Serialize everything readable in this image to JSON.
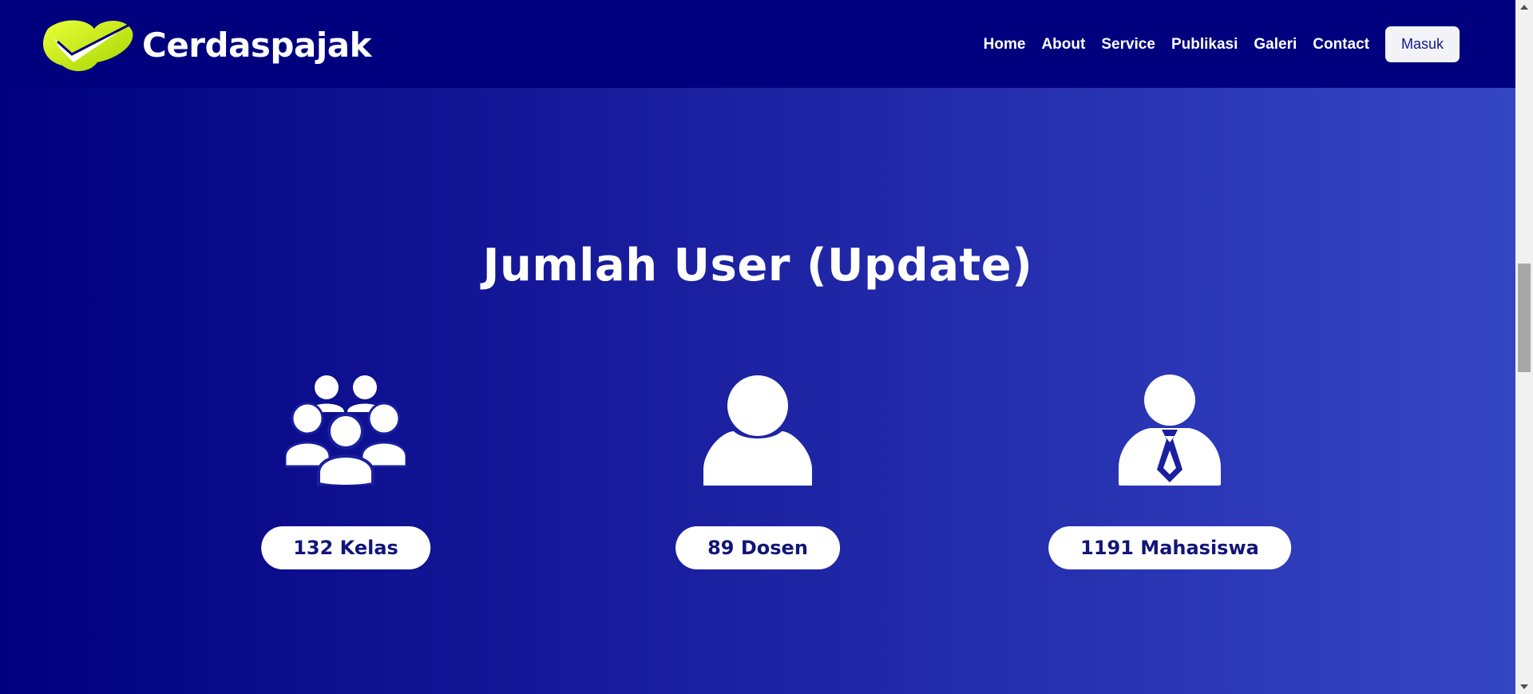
{
  "brand": {
    "name": "Cerdaspajak",
    "logo_icon": "check-mark-logo-icon",
    "logo_color": "#c6f511"
  },
  "nav": {
    "links": [
      "Home",
      "About",
      "Service",
      "Publikasi",
      "Galeri",
      "Contact"
    ],
    "login_label": "Masuk"
  },
  "section": {
    "title": "Jumlah User (Update)"
  },
  "stats": [
    {
      "icon": "group-users-icon",
      "label": "132 Kelas"
    },
    {
      "icon": "user-icon",
      "label": "89 Dosen"
    },
    {
      "icon": "user-tie-icon",
      "label": "1191 Mahasiswa"
    }
  ],
  "colors": {
    "nav_bg": "#00007f",
    "gradient_end": "#3546c4",
    "pill_text": "#13157a"
  }
}
